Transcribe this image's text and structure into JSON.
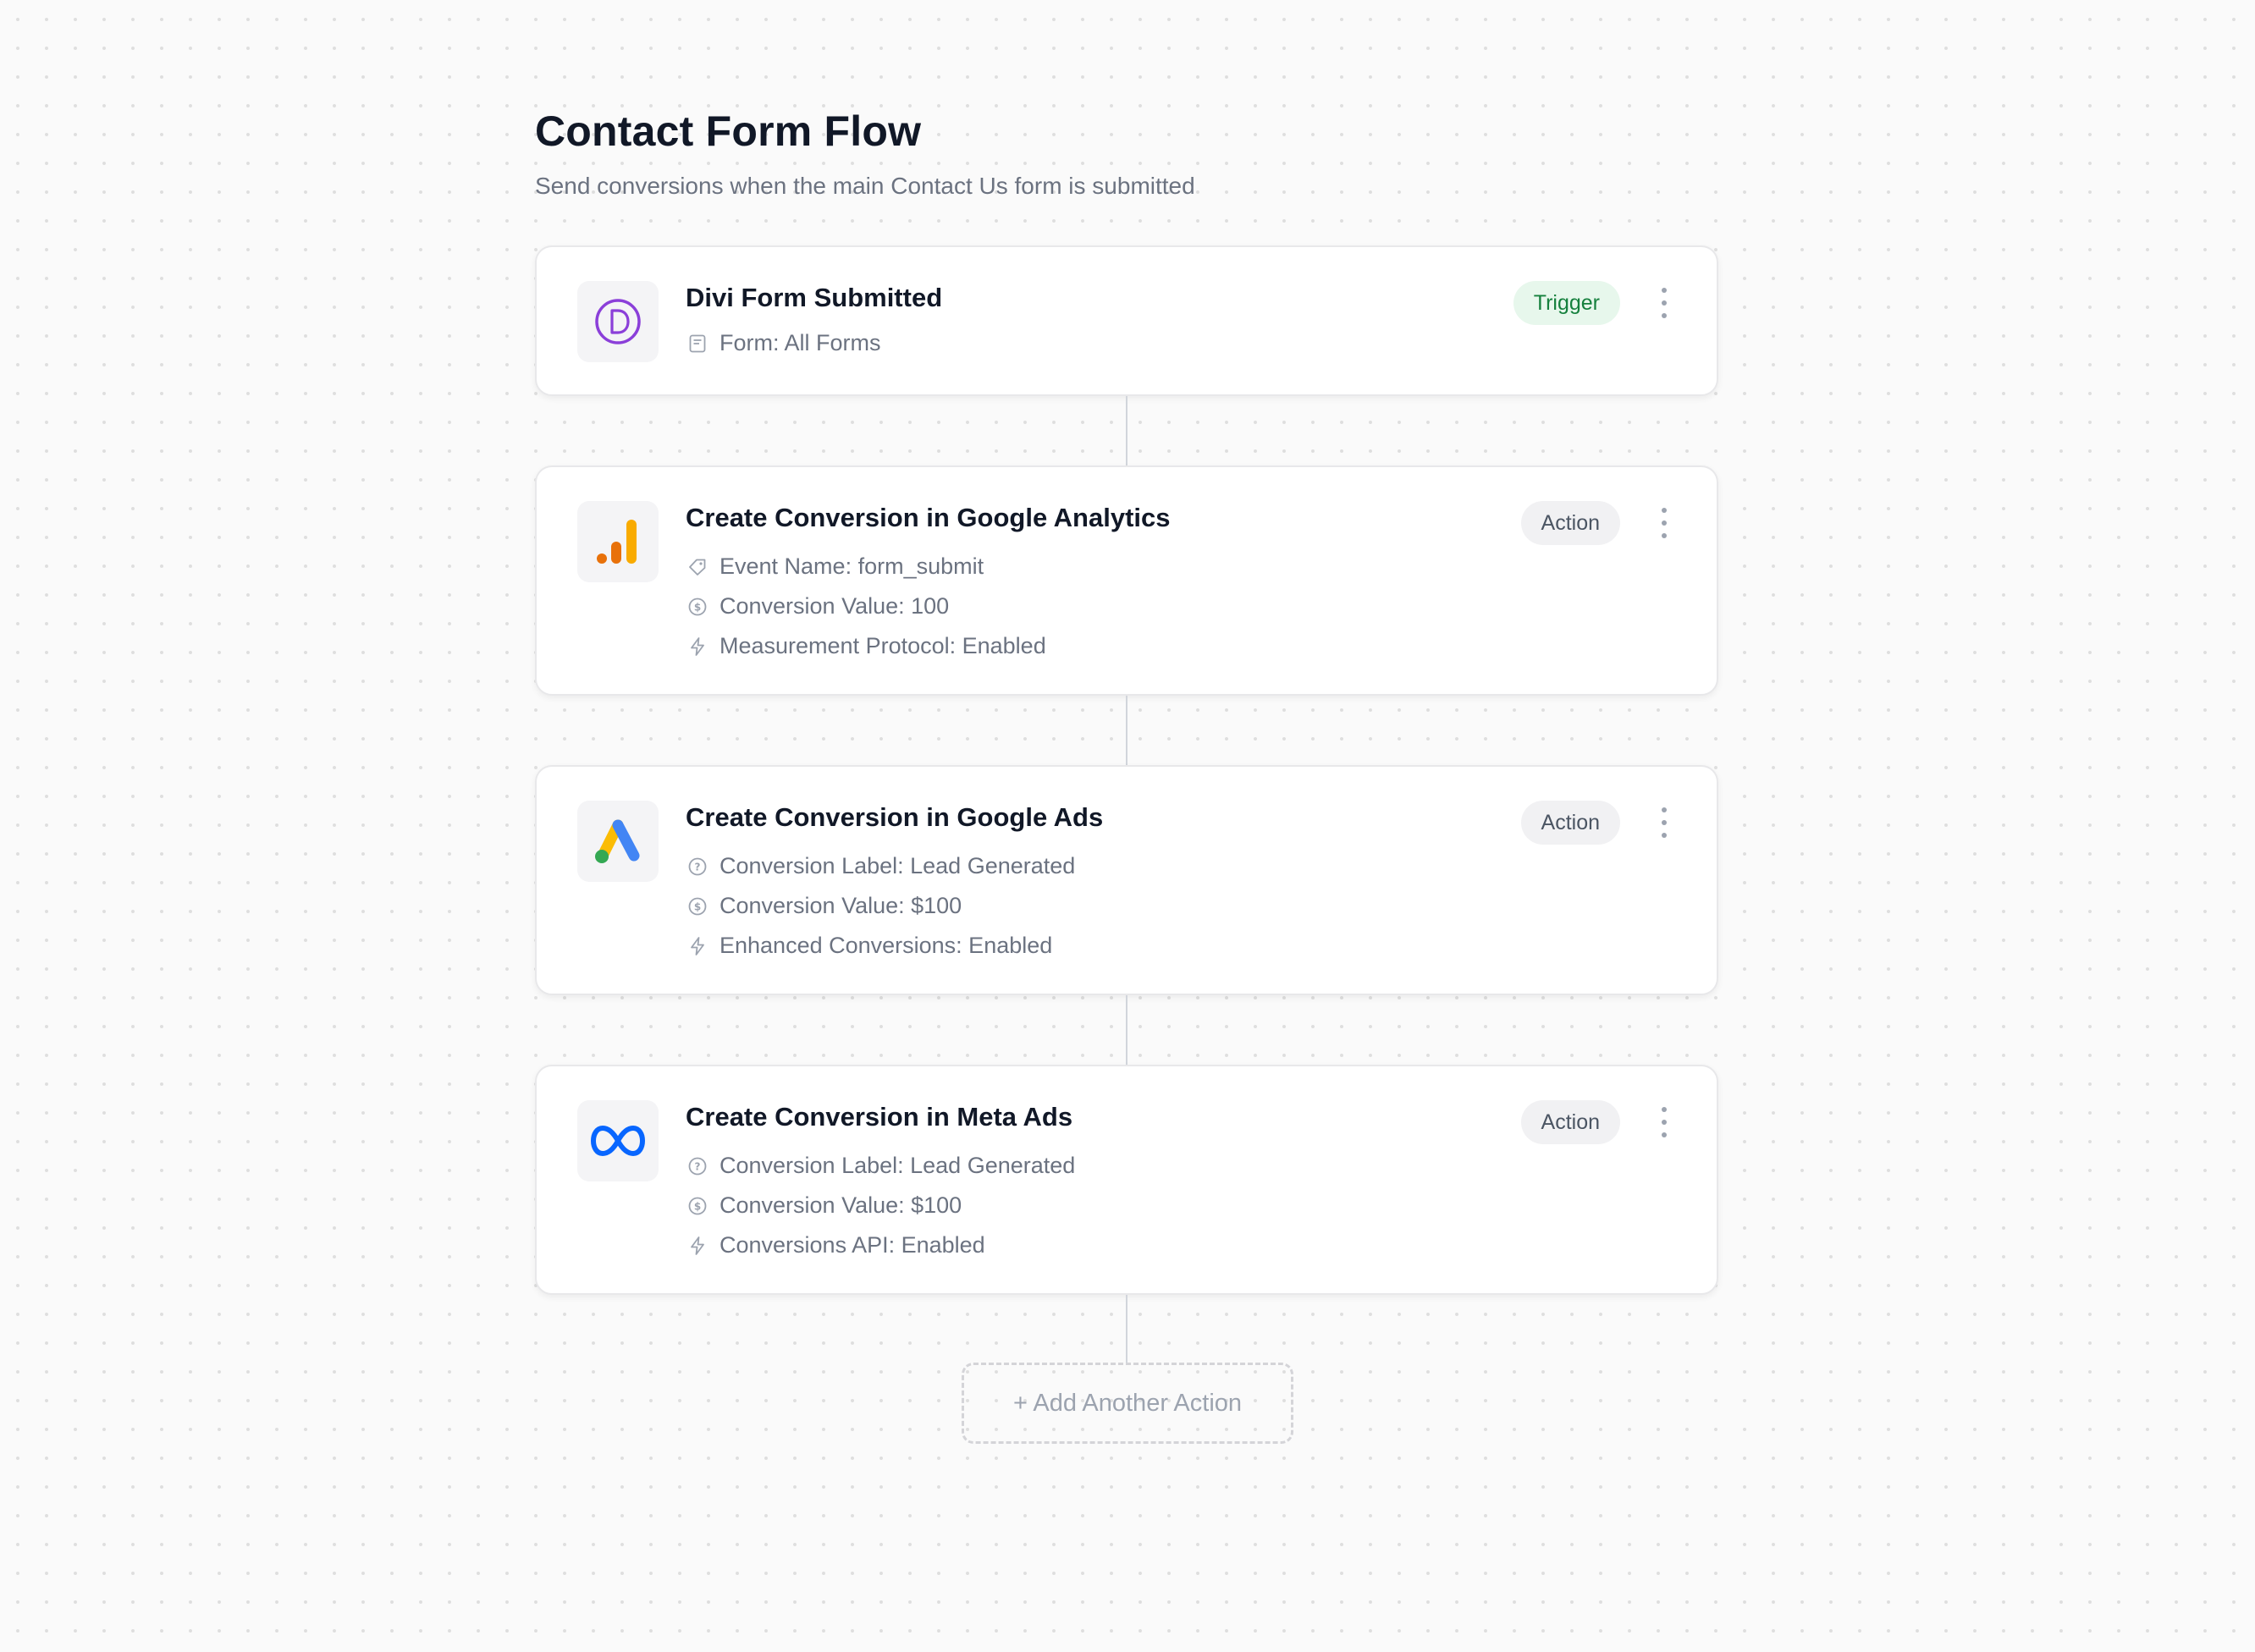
{
  "header": {
    "title": "Contact Form Flow",
    "subtitle": "Send conversions when the main Contact Us form is submitted"
  },
  "steps": [
    {
      "title": "Divi Form Submitted",
      "badge": "Trigger",
      "logo": "divi-logo",
      "details": [
        {
          "icon": "form-icon",
          "text": "Form: All Forms"
        }
      ]
    },
    {
      "title": "Create Conversion in Google Analytics",
      "badge": "Action",
      "logo": "google-analytics-logo",
      "details": [
        {
          "icon": "tag-icon",
          "text": "Event Name: form_submit"
        },
        {
          "icon": "dollar-circle-icon",
          "text": "Conversion Value: 100"
        },
        {
          "icon": "lightning-icon",
          "text": "Measurement Protocol: Enabled"
        }
      ]
    },
    {
      "title": "Create Conversion in Google Ads",
      "badge": "Action",
      "logo": "google-ads-logo",
      "details": [
        {
          "icon": "question-circle-icon",
          "text": "Conversion Label: Lead Generated"
        },
        {
          "icon": "dollar-circle-icon",
          "text": "Conversion Value: $100"
        },
        {
          "icon": "lightning-icon",
          "text": "Enhanced Conversions: Enabled"
        }
      ]
    },
    {
      "title": "Create Conversion in Meta Ads",
      "badge": "Action",
      "logo": "meta-logo",
      "details": [
        {
          "icon": "question-circle-icon",
          "text": "Conversion Label: Lead Generated"
        },
        {
          "icon": "dollar-circle-icon",
          "text": "Conversion Value: $100"
        },
        {
          "icon": "lightning-icon",
          "text": "Conversions API: Enabled"
        }
      ]
    }
  ],
  "add_action_label": "+ Add Another Action",
  "colors": {
    "trigger_badge_bg": "#e7f7ec",
    "trigger_badge_text": "#15803d",
    "action_badge_bg": "#f1f1f3",
    "divi_purple": "#8b3fd9",
    "ga_orange": "#e8710a",
    "ga_yellow": "#f9ab00",
    "gads_blue": "#4285f4",
    "gads_yellow": "#fbbc04",
    "gads_green": "#34a853",
    "meta_blue": "#0866ff"
  }
}
